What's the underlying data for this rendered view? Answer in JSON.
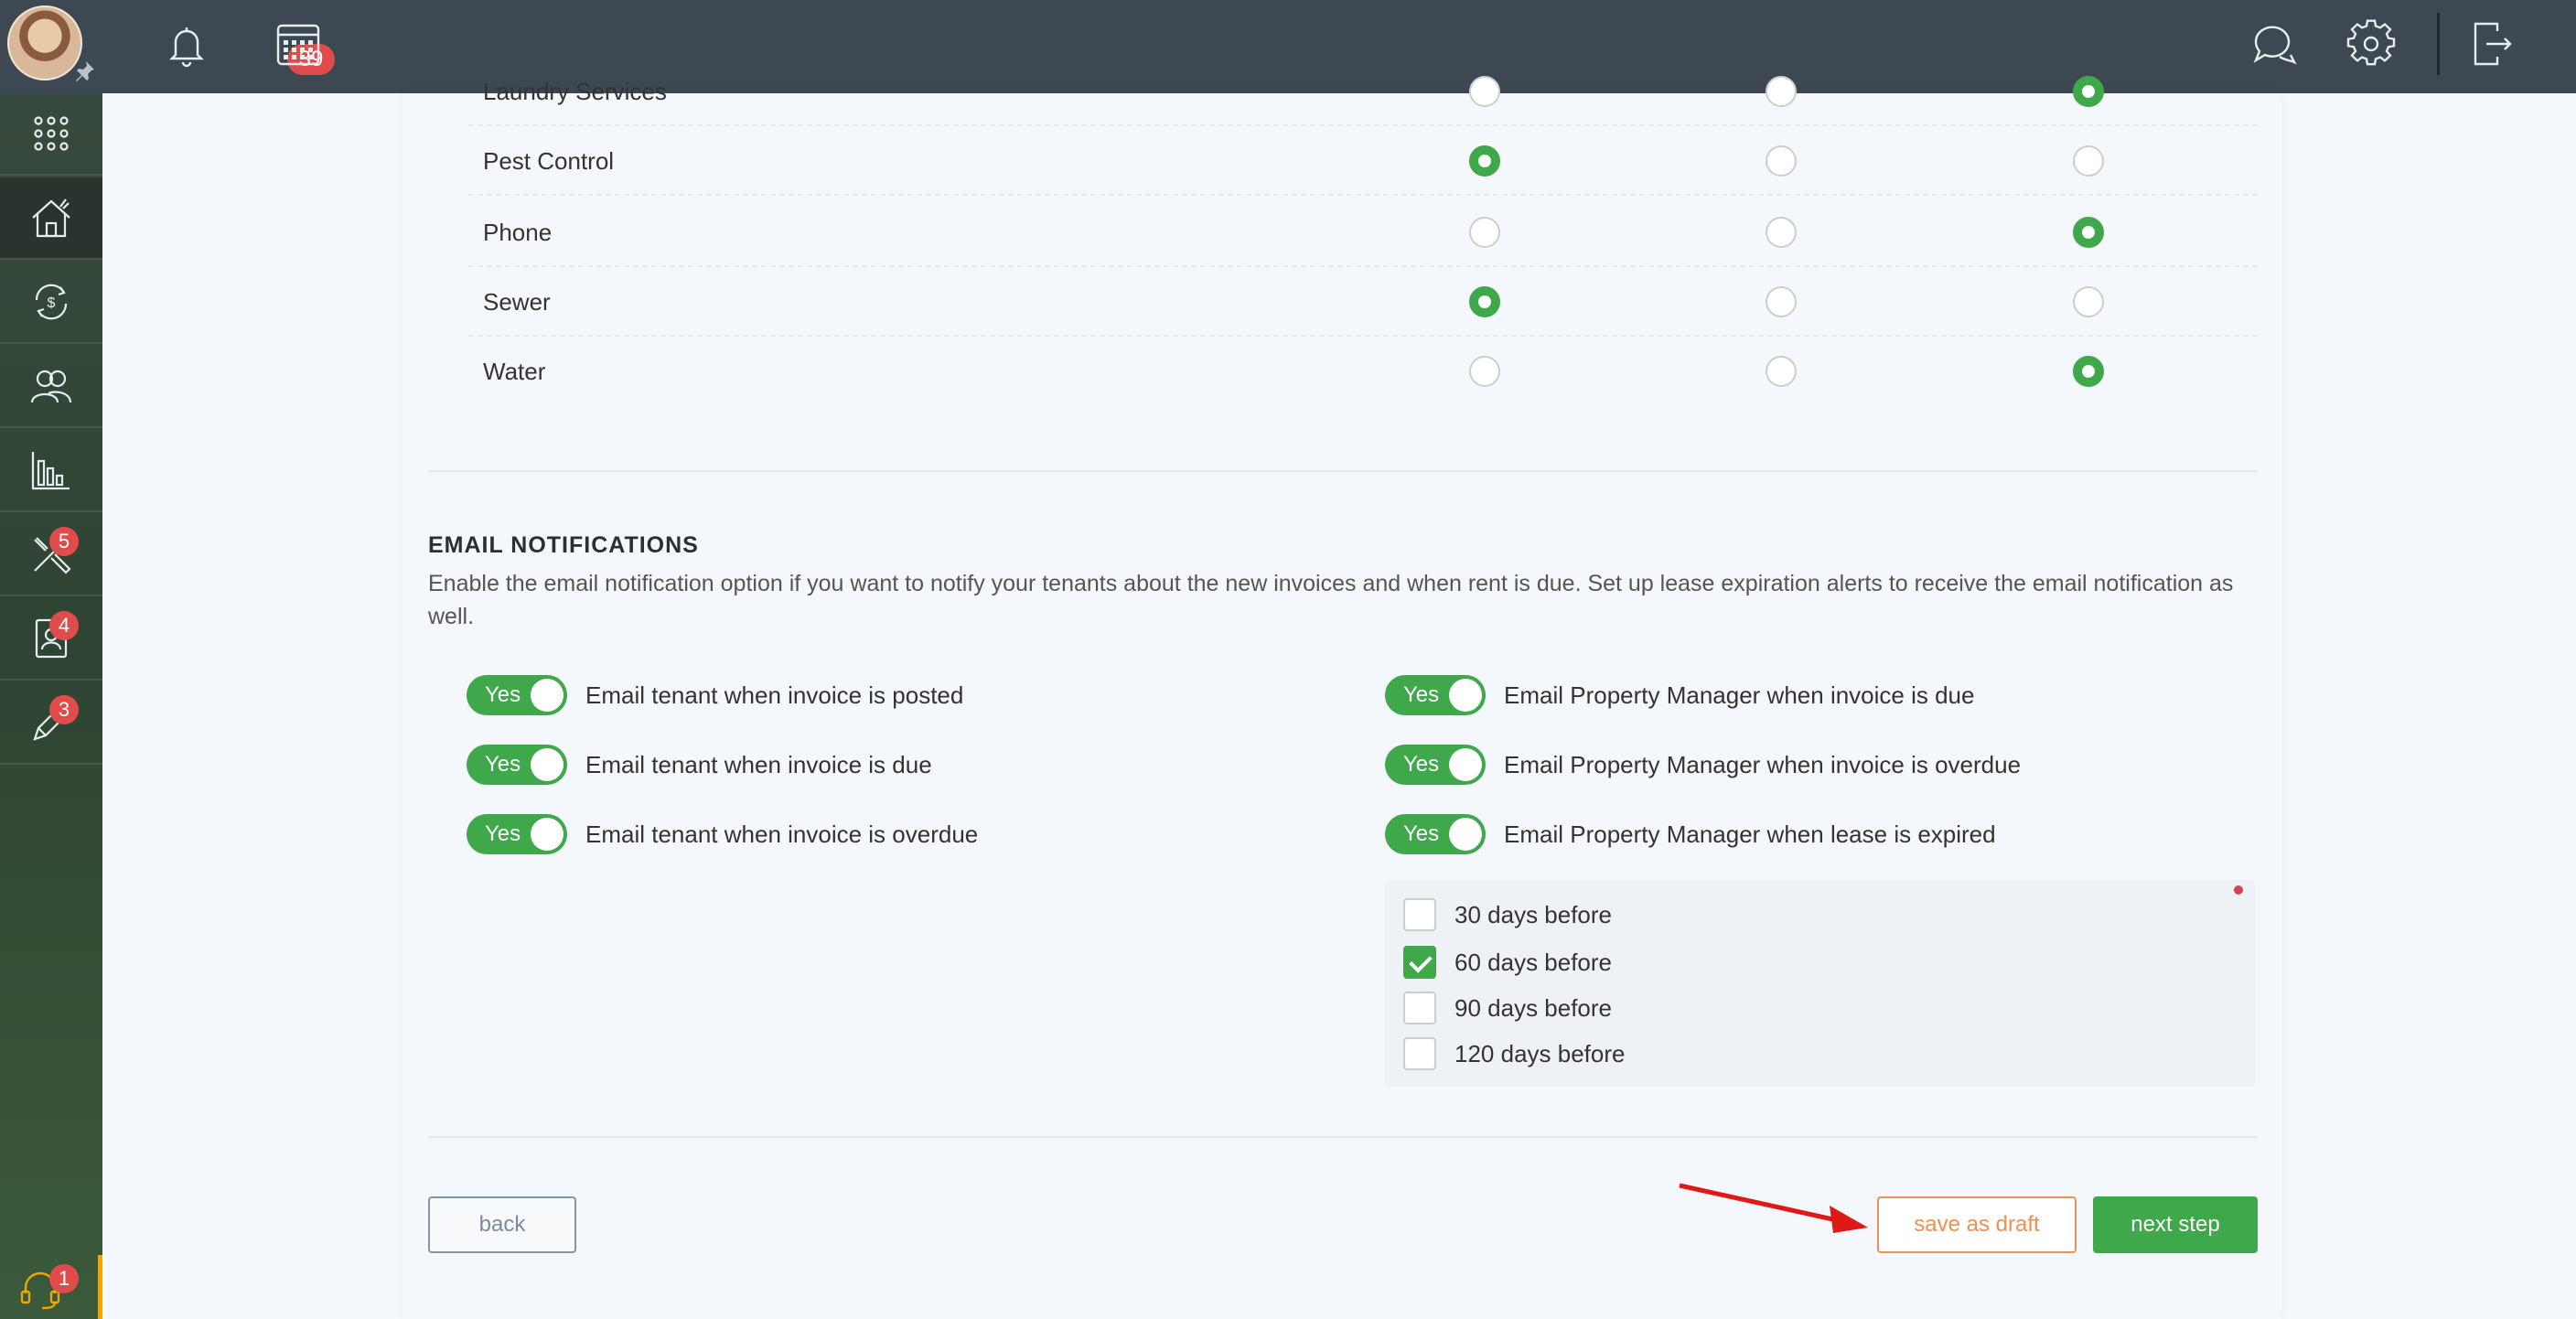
{
  "topbar": {
    "notifications_count": "39"
  },
  "sidebar": {
    "badges": {
      "maintenance": "5",
      "tenants": "4",
      "leases": "3",
      "support": "1"
    }
  },
  "utilities": [
    {
      "name": "Laundry Services",
      "selected": 3
    },
    {
      "name": "Pest Control",
      "selected": 1
    },
    {
      "name": "Phone",
      "selected": 3
    },
    {
      "name": "Sewer",
      "selected": 1
    },
    {
      "name": "Water",
      "selected": 3
    }
  ],
  "email_notifications": {
    "title": "EMAIL NOTIFICATIONS",
    "description": "Enable the email notification option if you want to notify your tenants about the new invoices and when rent is due. Set up lease expiration alerts to receive the email notification as well.",
    "toggle_label": "Yes",
    "left": [
      "Email tenant when invoice is posted",
      "Email tenant when invoice is due",
      "Email tenant when invoice is overdue"
    ],
    "right": [
      "Email Property Manager when invoice is due",
      "Email Property Manager when invoice is overdue",
      "Email Property Manager when lease is expired"
    ],
    "days_options": [
      {
        "label": "30 days before",
        "checked": false
      },
      {
        "label": "60 days before",
        "checked": true
      },
      {
        "label": "90 days before",
        "checked": false
      },
      {
        "label": "120 days before",
        "checked": false
      }
    ]
  },
  "buttons": {
    "back": "back",
    "save_draft": "save as draft",
    "next": "next step"
  },
  "colors": {
    "accent_green": "#3ea84a",
    "draft_orange": "#ef8f52",
    "badge_red": "#e24b4b",
    "topbar": "#3d4852"
  }
}
